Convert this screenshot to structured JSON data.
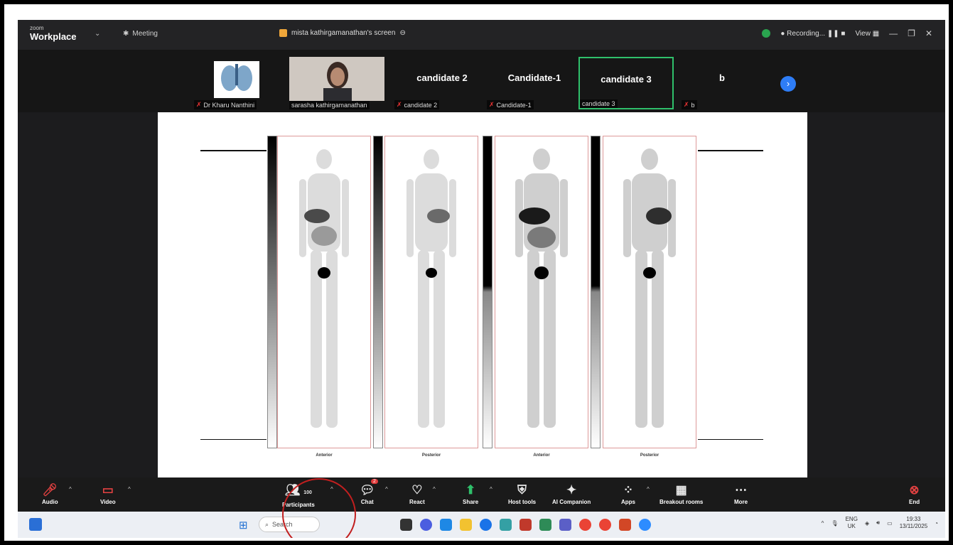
{
  "titlebar": {
    "logo_small": "zoom",
    "logo_big": "Workplace",
    "meeting_label": "Meeting",
    "share_title": "mista kathirgamanathan's screen",
    "recording_label": "Recording...",
    "view_label": "View"
  },
  "participants": [
    {
      "name": "",
      "label": "Dr Kharu Nanthini"
    },
    {
      "name": "",
      "label": "sarasha kathirgamanathan"
    },
    {
      "name": "candidate 2",
      "label": "candidate 2"
    },
    {
      "name": "Candidate-1",
      "label": "Candidate-1"
    },
    {
      "name": "candidate 3",
      "label": "candidate 3"
    },
    {
      "name": "b",
      "label": "b"
    }
  ],
  "scan_labels": [
    "Anterior",
    "Posterior",
    "Anterior",
    "Posterior"
  ],
  "controls": {
    "audio": "Audio",
    "video": "Video",
    "participants": "Participants",
    "participants_count": "100",
    "chat": "Chat",
    "chat_badge": "2",
    "react": "React",
    "share": "Share",
    "host_tools": "Host tools",
    "ai_companion": "AI Companion",
    "apps": "Apps",
    "breakout_rooms": "Breakout rooms",
    "more": "More",
    "end": "End"
  },
  "taskbar": {
    "search_placeholder": "Search",
    "lang_top": "ENG",
    "lang_bottom": "UK",
    "time": "19:33",
    "date": "13/11/2025"
  }
}
